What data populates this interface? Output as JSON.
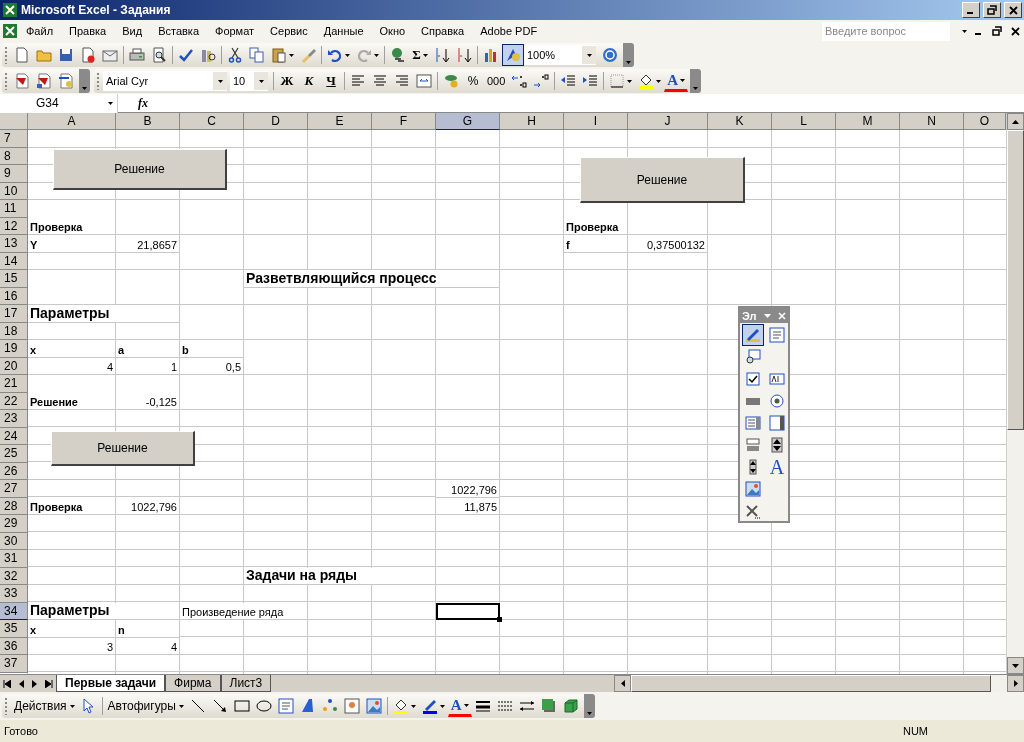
{
  "window": {
    "title": "Microsoft Excel - Задания"
  },
  "menu": {
    "items": [
      "Файл",
      "Правка",
      "Вид",
      "Вставка",
      "Формат",
      "Сервис",
      "Данные",
      "Окно",
      "Справка",
      "Adobe PDF"
    ],
    "help_placeholder": "Введите вопрос"
  },
  "standard_toolbar": {
    "sum_label": "Σ",
    "zoom": "100%",
    "drawing_on": true
  },
  "formatting_toolbar": {
    "font": "Arial Cyr",
    "size": "10",
    "bold": "Ж",
    "italic": "К",
    "underline": "Ч",
    "percent": "%",
    "thousands": "000",
    "font_color": "A"
  },
  "formula_bar": {
    "name_box": "G34",
    "fx_label": "fx"
  },
  "columns": [
    {
      "label": "A",
      "selected": false
    },
    {
      "label": "B",
      "selected": false
    },
    {
      "label": "C",
      "selected": false
    },
    {
      "label": "D",
      "selected": false
    },
    {
      "label": "E",
      "selected": false
    },
    {
      "label": "F",
      "selected": false
    },
    {
      "label": "G",
      "selected": true
    },
    {
      "label": "H",
      "selected": false
    },
    {
      "label": "I",
      "selected": false
    },
    {
      "label": "J",
      "selected": false
    },
    {
      "label": "K",
      "selected": false
    },
    {
      "label": "L",
      "selected": false
    },
    {
      "label": "M",
      "selected": false
    },
    {
      "label": "N",
      "selected": false
    },
    {
      "label": "O",
      "selected": false
    }
  ],
  "rows": [
    {
      "number": "7",
      "selected": false
    },
    {
      "number": "8",
      "selected": false
    },
    {
      "number": "9",
      "selected": false
    },
    {
      "number": "10",
      "selected": false
    },
    {
      "number": "11",
      "selected": false
    },
    {
      "number": "12",
      "selected": false,
      "cells": [
        {
          "text": "Проверка",
          "kind": "label"
        },
        {},
        {},
        {},
        {},
        {},
        {},
        {},
        {
          "text": "Проверка",
          "kind": "label"
        }
      ]
    },
    {
      "number": "13",
      "selected": false,
      "cells": [
        {
          "text": "Y",
          "kind": "label"
        },
        {
          "text": "21,8657",
          "kind": "number"
        },
        {},
        {},
        {},
        {},
        {},
        {},
        {
          "text": "f",
          "kind": "label"
        },
        {
          "text": "0,37500132",
          "kind": "number"
        }
      ]
    },
    {
      "number": "14",
      "selected": false
    },
    {
      "number": "15",
      "selected": false,
      "cells": [
        {},
        {},
        {},
        {
          "text": "Разветвляющийся процесс",
          "kind": "heading"
        }
      ]
    },
    {
      "number": "16",
      "selected": false
    },
    {
      "number": "17",
      "selected": false,
      "cells": [
        {
          "text": "Параметры",
          "kind": "heading"
        }
      ]
    },
    {
      "number": "18",
      "selected": false
    },
    {
      "number": "19",
      "selected": false,
      "cells": [
        {
          "text": "x",
          "kind": "label"
        },
        {
          "text": "a",
          "kind": "label"
        },
        {
          "text": "b",
          "kind": "label"
        }
      ]
    },
    {
      "number": "20",
      "selected": false,
      "cells": [
        {
          "text": "4",
          "kind": "number"
        },
        {
          "text": "1",
          "kind": "number"
        },
        {
          "text": "0,5",
          "kind": "number"
        }
      ]
    },
    {
      "number": "21",
      "selected": false
    },
    {
      "number": "22",
      "selected": false,
      "cells": [
        {
          "text": "Решение",
          "kind": "label"
        },
        {
          "text": "-0,125",
          "kind": "number"
        }
      ]
    },
    {
      "number": "23",
      "selected": false
    },
    {
      "number": "24",
      "selected": false
    },
    {
      "number": "25",
      "selected": false
    },
    {
      "number": "26",
      "selected": false
    },
    {
      "number": "27",
      "selected": false,
      "cells": [
        {},
        {},
        {},
        {},
        {},
        {},
        {
          "text": "1022,796",
          "kind": "number"
        }
      ]
    },
    {
      "number": "28",
      "selected": false,
      "cells": [
        {
          "text": "Проверка",
          "kind": "label"
        },
        {
          "text": "1022,796",
          "kind": "number"
        },
        {},
        {},
        {},
        {},
        {
          "text": "11,875",
          "kind": "number"
        }
      ]
    },
    {
      "number": "29",
      "selected": false
    },
    {
      "number": "30",
      "selected": false
    },
    {
      "number": "31",
      "selected": false
    },
    {
      "number": "32",
      "selected": false,
      "cells": [
        {},
        {},
        {},
        {
          "text": "Задачи на ряды",
          "kind": "heading"
        }
      ]
    },
    {
      "number": "33",
      "selected": false
    },
    {
      "number": "34",
      "selected": true,
      "cells": [
        {
          "text": "Параметры",
          "kind": "heading"
        },
        {},
        {
          "text": "Произведение ряда",
          "kind": "text"
        }
      ]
    },
    {
      "number": "35",
      "selected": false,
      "cells": [
        {
          "text": "x",
          "kind": "label"
        },
        {
          "text": "n",
          "kind": "label"
        }
      ]
    },
    {
      "number": "36",
      "selected": false,
      "cells": [
        {
          "text": "3",
          "kind": "number"
        },
        {
          "text": "4",
          "kind": "number"
        }
      ]
    },
    {
      "number": "37",
      "selected": false
    }
  ],
  "form_buttons": [
    {
      "label": "Решение"
    },
    {
      "label": "Решение"
    },
    {
      "label": "Решение"
    }
  ],
  "controls_toolbar": {
    "title": "Эл",
    "text_label": "A",
    "design_mode_on": true
  },
  "sheet_tabs": [
    {
      "label": "Первые задачи",
      "selected": true
    },
    {
      "label": "Фирма",
      "selected": false
    },
    {
      "label": "Лист3",
      "selected": false
    }
  ],
  "drawing_toolbar": {
    "actions": "Действия",
    "autoshapes": "Автофигуры",
    "font_color": "A"
  },
  "status_bar": {
    "message": "Готово",
    "indicator": "NUM"
  }
}
